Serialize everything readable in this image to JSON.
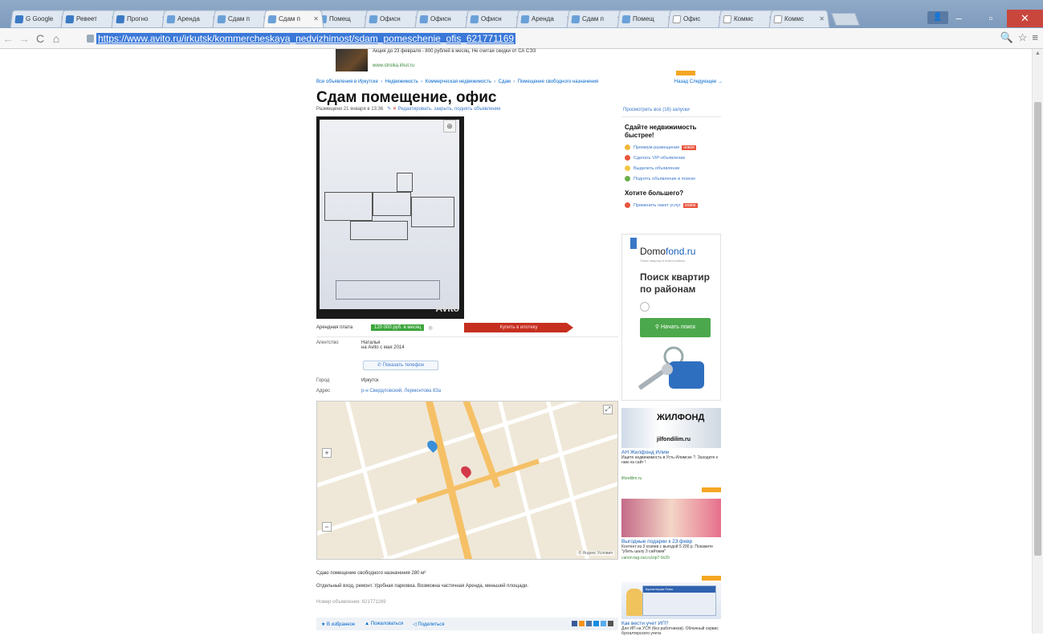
{
  "browser": {
    "tabs": [
      {
        "title": "G Google",
        "icon": "google-icon"
      },
      {
        "title": "Ревеет",
        "icon": "mail-icon"
      },
      {
        "title": "Прогно",
        "icon": "mail-icon"
      },
      {
        "title": "Аренда",
        "icon": "avito-icon"
      },
      {
        "title": "Сдам п",
        "icon": "avito-icon"
      },
      {
        "title": "Сдам п",
        "icon": "avito-icon",
        "active": true
      },
      {
        "title": "Помещ",
        "icon": "avito-icon"
      },
      {
        "title": "Офисн",
        "icon": "avito-icon"
      },
      {
        "title": "Офисн",
        "icon": "avito-icon"
      },
      {
        "title": "Офисн",
        "icon": "avito-icon"
      },
      {
        "title": "Аренда",
        "icon": "avito-icon"
      },
      {
        "title": "Сдам п",
        "icon": "avito-icon"
      },
      {
        "title": "Помещ",
        "icon": "avito-icon"
      },
      {
        "title": "Офис",
        "icon": "doc-icon"
      },
      {
        "title": "Коммс",
        "icon": "doc-icon"
      },
      {
        "title": "Коммс",
        "icon": "doc-icon"
      }
    ],
    "url": "https://www.avito.ru/irkutsk/kommercheskaya_nedvizhimost/sdam_pomeschenie_ofis_621771169",
    "window_controls": {
      "minimize": "–",
      "maximize": "▫",
      "close": "✕"
    }
  },
  "banner": {
    "text": "Акция до 23 февраля - 800 рублей в месяц. Не считая скидки от СА СЭЗ",
    "url": "www.stroika.irkut.ru"
  },
  "breadcrumbs": {
    "items": [
      "Все объявления в Иркутске",
      "Недвижимость",
      "Коммерческая недвижимость",
      "Сдам",
      "Помещение свободного назначения"
    ],
    "next": "Назад  Следующее →"
  },
  "listing": {
    "title": "Сдам помещение, офис",
    "meta_posted": "Размещено 21 января в 13:36",
    "meta_actions": "Редактировать, закрыть, поднять объявление",
    "price_label": "Арендная плата",
    "price": "120 000 руб. в месяц",
    "currency_icon": "currency-icon",
    "buy_button": "Купить в ипотеку",
    "agency_label": "Агентство",
    "agency_name": "Наталья",
    "agency_since": "на Avito с мая 2014",
    "phone_button": "Показать телефон",
    "city_label": "Город",
    "city": "Иркутск",
    "address_label": "Адрес",
    "address": "р-н Свердловский, Лермонтова 83а",
    "description_1": "Сдаю помещение свободного назначения 280 м²",
    "description_2": "Отдельный вход, ремонт. Удобная парковка. Возможна частичная Аренда, меньшей площади.",
    "ad_number": "Номер объявления: 621771169",
    "watermark": "Avito",
    "actions": {
      "favorite": "★ В избранное",
      "report": "▲ Пожаловаться",
      "share": "◁ Поделиться"
    },
    "map_copyright": "© Яндекс  Условия"
  },
  "sidebar": {
    "view_all": "Просмотреть все (16) запуски",
    "sell_title": "Сдайте недвижимость быстрее!",
    "services": [
      {
        "label": "Премиум-размещение",
        "badge": "новое",
        "color": "#f2b73a"
      },
      {
        "label": "Сделать VIP-объявление",
        "badge": "",
        "color": "#e8553d"
      },
      {
        "label": "Выделить объявление",
        "badge": "",
        "color": "#f2c744"
      },
      {
        "label": "Поднять объявление в поиске",
        "badge": "",
        "color": "#6ab04c"
      }
    ],
    "more_title": "Хотите большего?",
    "more_service": {
      "label": "Применить пакет услуг",
      "badge": "новое"
    },
    "domofond": {
      "logo_a": "Domo",
      "logo_b": "fond.ru",
      "tagline": "Поиск квартир в новостройках",
      "headline": "Поиск квартир по районам",
      "button": "Начать поиск"
    },
    "ad_jilfond": {
      "brand": "ЖИЛФОНД",
      "site": "jilfondilim.ru",
      "title": "АН Жилфонд Илим",
      "text": "Ищете недвижимость в Усть-Илимске ?. Заходите к нам на сайт !",
      "url": "ilfondilim.ru"
    },
    "ad_gifts": {
      "title": "Выгодные подарки к 23 февр",
      "text": "Контент из 3 хозяев с выгодой 5 200 р. Покажите \"убить шалу 3 сайтами\"",
      "url": "canon-tag-out.ru/zip7-9x20"
    },
    "ad_account": {
      "header": "Бухгалтерия Плюс",
      "title": "Как вести учет ИП?",
      "text": "Для ИП на УСН (без работников). Облачный сервис бухгалтерского учета"
    }
  }
}
